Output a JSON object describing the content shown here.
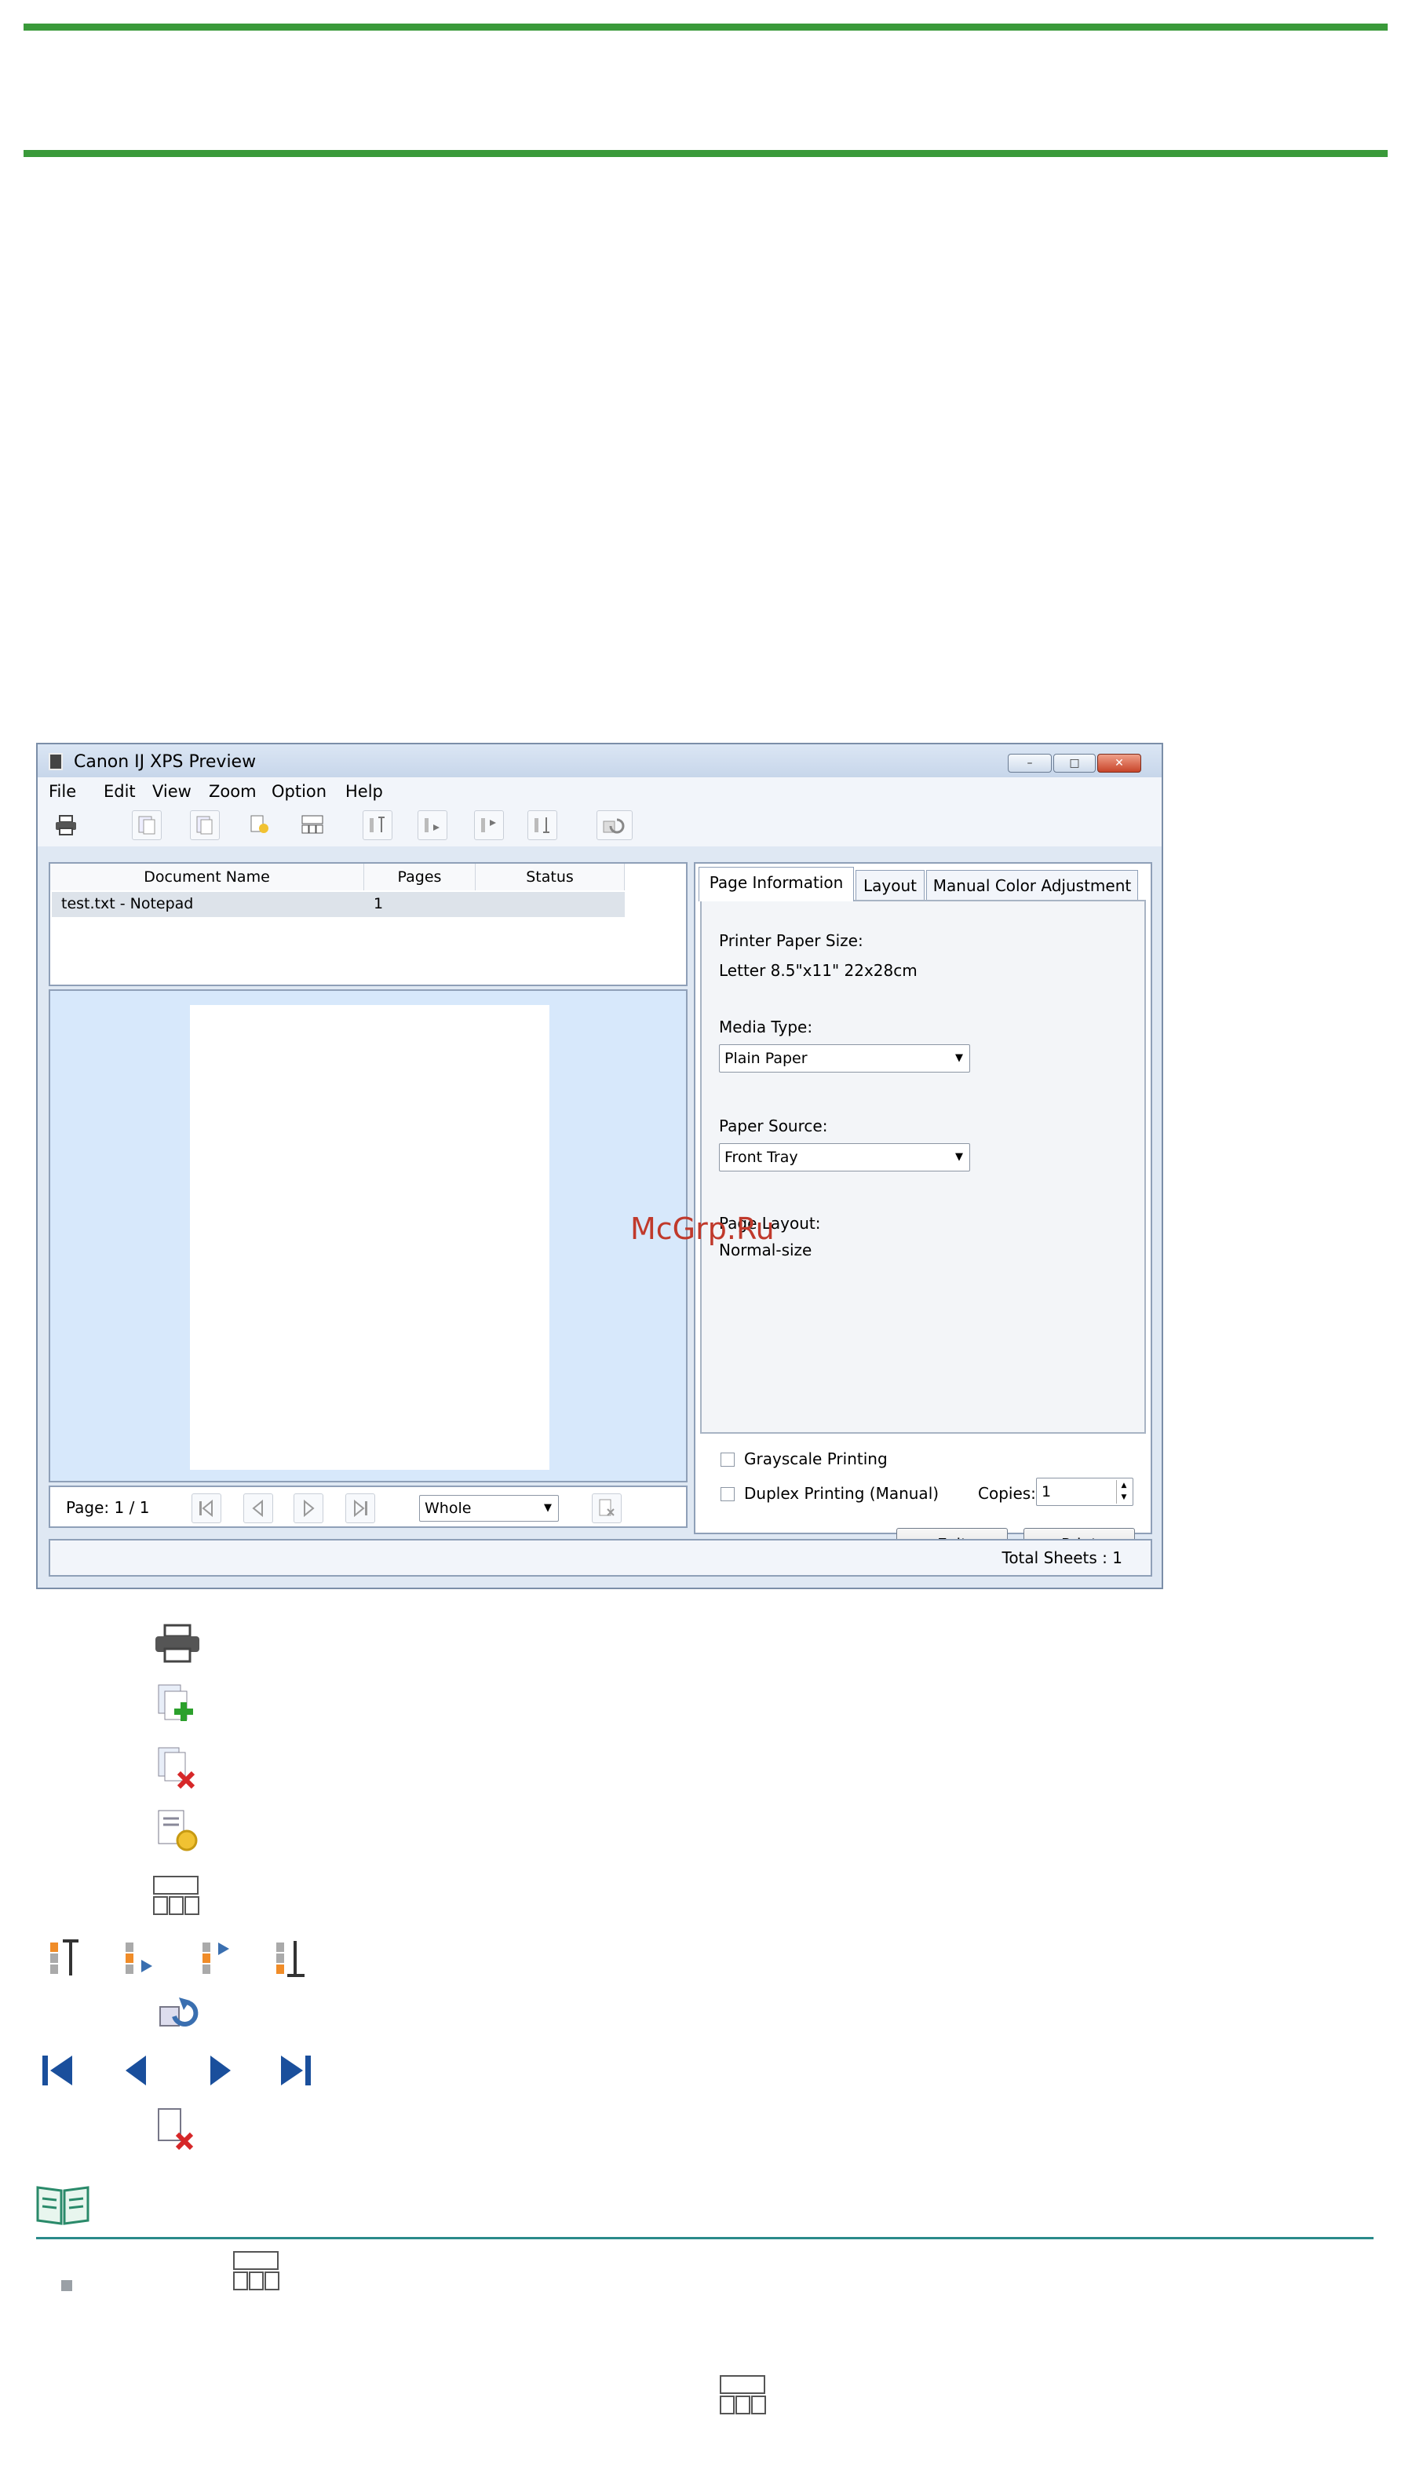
{
  "window": {
    "title": "Canon IJ XPS Preview",
    "minimize_glyph": "–",
    "maximize_glyph": "□",
    "close_glyph": "✕"
  },
  "menu": [
    "File",
    "Edit",
    "View",
    "Zoom",
    "Option",
    "Help"
  ],
  "doc_list": {
    "columns": [
      "Document Name",
      "Pages",
      "Status"
    ],
    "rows": [
      {
        "name": "test.txt - Notepad",
        "pages": "1",
        "status": ""
      }
    ]
  },
  "nav": {
    "page_label": "Page:  1 / 1",
    "zoom_value": "Whole"
  },
  "tabs": [
    "Page Information",
    "Layout",
    "Manual Color Adjustment"
  ],
  "page_info": {
    "paper_size_label": "Printer Paper Size:",
    "paper_size_value": "Letter 8.5\"x11\" 22x28cm",
    "media_type_label": "Media Type:",
    "media_type_value": "Plain Paper",
    "paper_source_label": "Paper Source:",
    "paper_source_value": "Front Tray",
    "page_layout_label": "Page Layout:",
    "page_layout_value": "Normal-size"
  },
  "options": {
    "grayscale_label": "Grayscale Printing",
    "duplex_label": "Duplex Printing (Manual)",
    "copies_label": "Copies:",
    "copies_value": "1"
  },
  "buttons": {
    "exit": "Exit",
    "print": "Print"
  },
  "status_bar": {
    "total_sheets": "Total Sheets  :  1"
  },
  "watermark": "McGrp.Ru",
  "colors": {
    "rule_green": "#3a9a3a",
    "preview_blue": "#d7e8fb",
    "note_teal": "#2a8a8a",
    "watermark_red": "#c0392b"
  },
  "icons": {
    "legend": [
      "print-icon",
      "add-document-icon",
      "delete-document-icon",
      "document-settings-icon",
      "thumbnails-icon",
      "move-first-icon",
      "move-up-icon",
      "move-down-icon",
      "move-last-icon",
      "undo-icon",
      "first-page-icon",
      "previous-page-icon",
      "next-page-icon",
      "last-page-icon",
      "delete-page-icon",
      "note-book-icon"
    ]
  }
}
